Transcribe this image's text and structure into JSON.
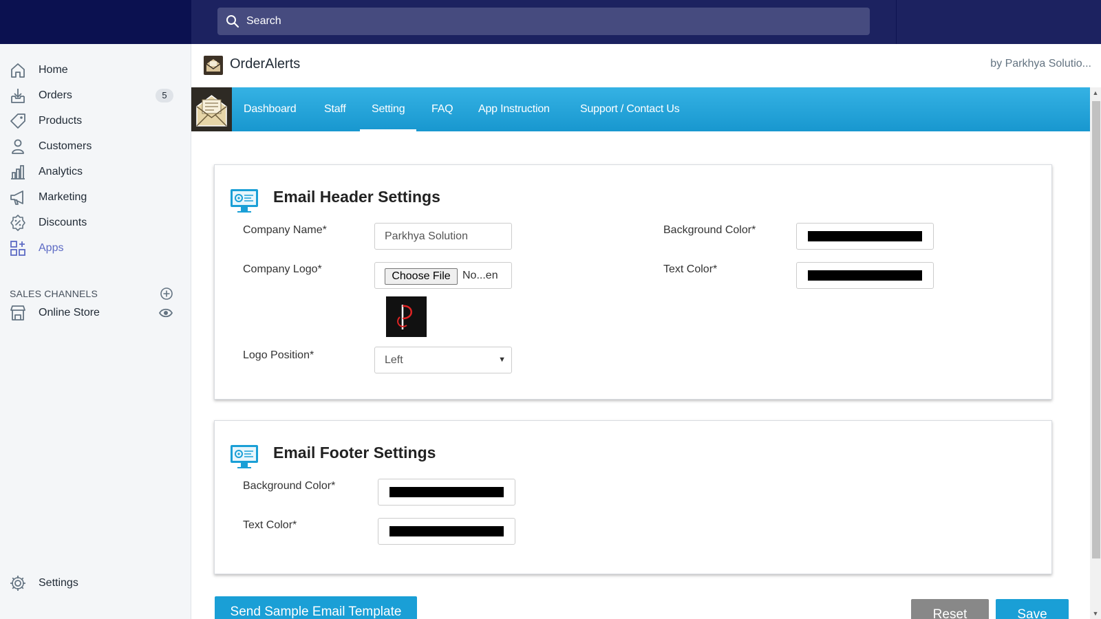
{
  "search": {
    "placeholder": "Search"
  },
  "sidebar": {
    "items": [
      {
        "label": "Home",
        "icon": "home-icon"
      },
      {
        "label": "Orders",
        "icon": "orders-icon",
        "badge": "5"
      },
      {
        "label": "Products",
        "icon": "tag-icon"
      },
      {
        "label": "Customers",
        "icon": "person-icon"
      },
      {
        "label": "Analytics",
        "icon": "bar-chart-icon"
      },
      {
        "label": "Marketing",
        "icon": "megaphone-icon"
      },
      {
        "label": "Discounts",
        "icon": "discount-icon"
      },
      {
        "label": "Apps",
        "icon": "apps-icon",
        "active": true
      }
    ],
    "sales_channels_title": "SALES CHANNELS",
    "online_store": "Online Store",
    "settings": "Settings"
  },
  "app": {
    "name": "OrderAlerts",
    "by": "by Parkhya Solutio..."
  },
  "tabs": [
    {
      "label": "Dashboard"
    },
    {
      "label": "Staff"
    },
    {
      "label": "Setting",
      "active": true
    },
    {
      "label": "FAQ"
    },
    {
      "label": "App Instruction"
    },
    {
      "label": "Support / Contact Us"
    }
  ],
  "header_settings": {
    "title": "Email Header Settings",
    "company_name_label": "Company Name*",
    "company_name_value": "Parkhya Solution",
    "company_logo_label": "Company Logo*",
    "choose_file": "Choose File",
    "file_text": "No...en",
    "logo_position_label": "Logo Position*",
    "logo_position_value": "Left",
    "bg_color_label": "Background Color*",
    "text_color_label": "Text Color*",
    "bg_color": "#000000",
    "text_color": "#000000"
  },
  "footer_settings": {
    "title": "Email Footer Settings",
    "bg_color_label": "Background Color*",
    "text_color_label": "Text Color*",
    "bg_color": "#000000",
    "text_color": "#000000"
  },
  "actions": {
    "send_sample": "Send Sample Email Template",
    "reset": "Reset",
    "save": "Save"
  },
  "colors": {
    "topbar": "#1c2260",
    "accent": "#1a9fd6",
    "sidebar_active": "#5c6ac4"
  }
}
